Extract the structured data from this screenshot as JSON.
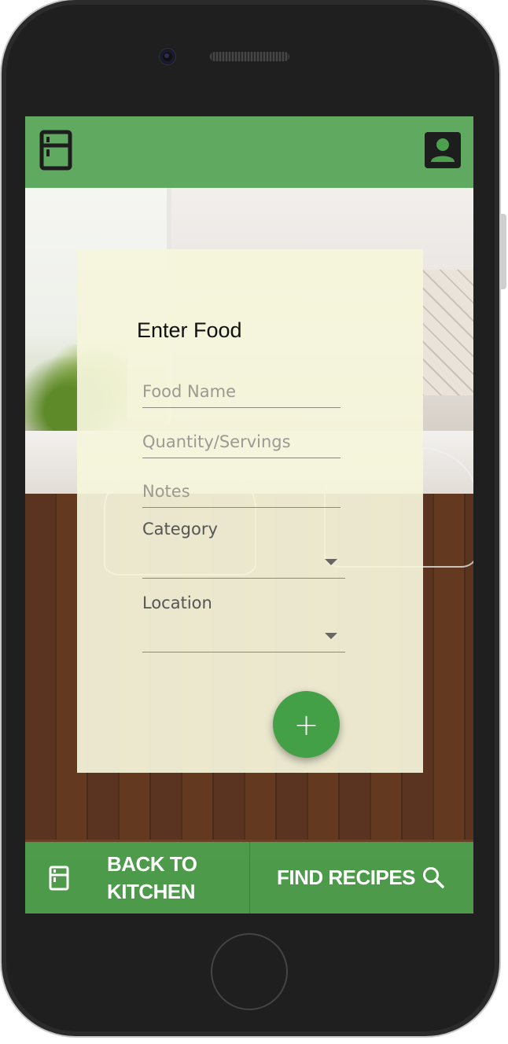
{
  "header": {
    "menu_icon": "fridge-icon",
    "profile_icon": "account-box-icon"
  },
  "form": {
    "title": "Enter Food",
    "food_name_placeholder": "Food Name",
    "quantity_placeholder": "Quantity/Servings",
    "notes_placeholder": "Notes",
    "category_label": "Category",
    "category_value": "",
    "location_label": "Location",
    "location_value": "",
    "add_label": "+"
  },
  "footer": {
    "back_line1": "BACK TO",
    "back_line2": "KITCHEN",
    "back_icon": "fridge-icon",
    "find_label": "FIND RECIPES",
    "find_icon": "search-icon"
  },
  "colors": {
    "primary": "#4CA04D",
    "fab": "#43A047",
    "card": "#F5F5DC"
  }
}
